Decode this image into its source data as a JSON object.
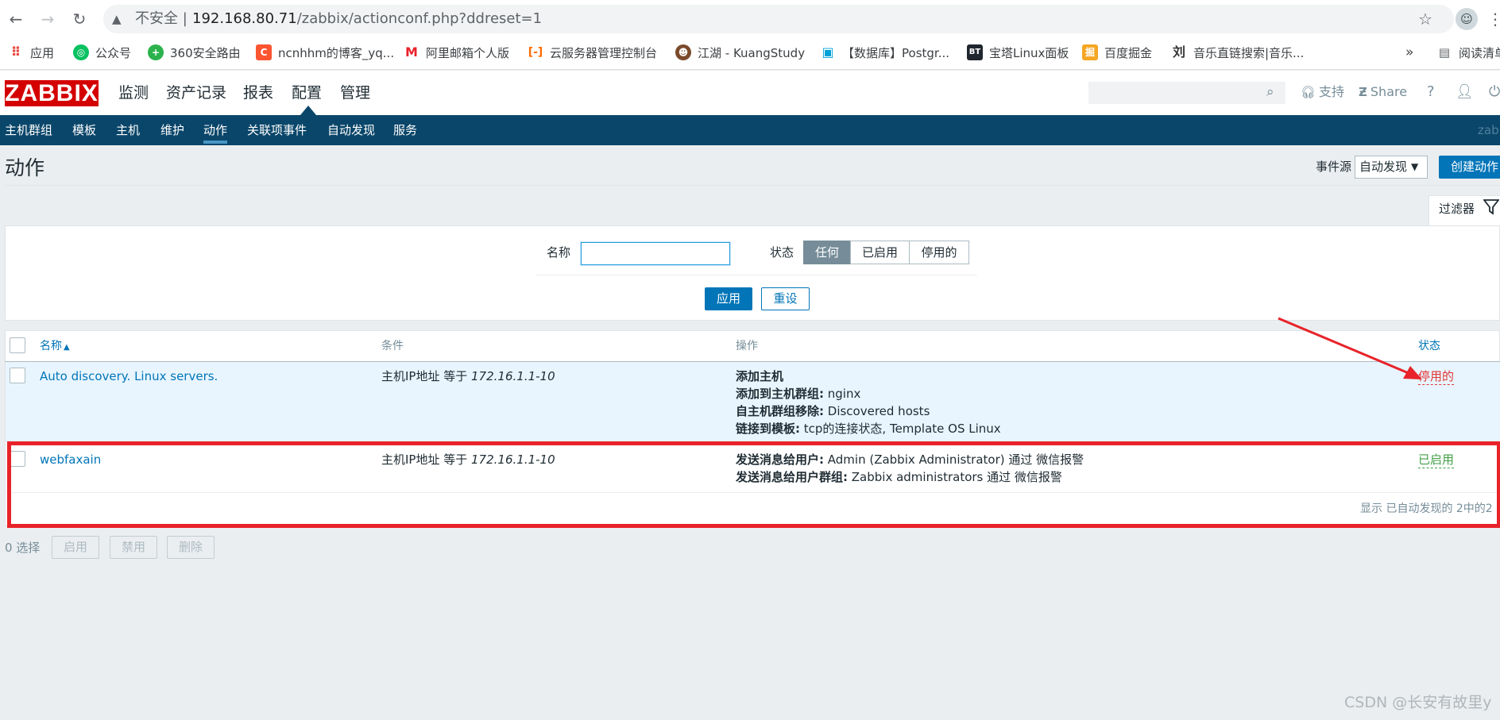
{
  "browser": {
    "insecure_label": "不安全",
    "url_host": "192.168.80.71",
    "url_path": "/zabbix/actionconf.php?ddreset=1",
    "bookmarks": [
      {
        "label": "应用",
        "icon": "apps-grid-icon",
        "color": "#e8453c"
      },
      {
        "label": "公众号",
        "icon": "wechat-icon",
        "color": "#07c160"
      },
      {
        "label": "360安全路由",
        "icon": "360-icon",
        "color": "#2bb24c"
      },
      {
        "label": "ncnhhm的博客_yq...",
        "icon": "csdn-c-icon",
        "color": "#fc5531"
      },
      {
        "label": "阿里邮箱个人版",
        "icon": "alimail-icon",
        "color": "#e8232a"
      },
      {
        "label": "云服务器管理控制台",
        "icon": "aliyun-icon",
        "color": "#ff6a00"
      },
      {
        "label": "江湖 - KuangStudy",
        "icon": "kuangstudy-icon",
        "color": "#7a4a2a"
      },
      {
        "label": "【数据库】Postgr...",
        "icon": "bilibili-icon",
        "color": "#00a1d6"
      },
      {
        "label": "宝塔Linux面板",
        "icon": "bt-icon",
        "color": "#20262e"
      },
      {
        "label": "百度掘金",
        "icon": "juejin-icon",
        "color": "#f5a623"
      },
      {
        "label": "音乐直链搜索|音乐...",
        "icon": "music-icon",
        "color": "#333333"
      }
    ],
    "more_bookmarks": "»",
    "reading_list": "阅读清单"
  },
  "header": {
    "logo": "ZABBIX",
    "menu": [
      "监测",
      "资产记录",
      "报表",
      "配置",
      "管理"
    ],
    "support": "支持",
    "share": "Share",
    "help": "?"
  },
  "subnav": {
    "items": [
      "主机群组",
      "模板",
      "主机",
      "维护",
      "动作",
      "关联项事件",
      "自动发现",
      "服务"
    ],
    "user": "zabb"
  },
  "page": {
    "title": "动作",
    "event_source_label": "事件源",
    "event_source_value": "自动发现",
    "create_button": "创建动作"
  },
  "filter": {
    "tab_label": "过滤器",
    "name_label": "名称",
    "name_value": "",
    "status_label": "状态",
    "status_options": [
      "任何",
      "已启用",
      "停用的"
    ],
    "apply": "应用",
    "reset": "重设"
  },
  "table": {
    "columns": {
      "name": "名称",
      "sort_indicator": "▲",
      "conditions": "条件",
      "operations": "操作",
      "status": "状态"
    },
    "rows": [
      {
        "name": "Auto discovery. Linux servers.",
        "condition_prefix": "主机IP地址 等于 ",
        "condition_value": "172.16.1.1-10",
        "operations": [
          {
            "label": "添加主机",
            "value": ""
          },
          {
            "label": "添加到主机群组:",
            "value": " nginx"
          },
          {
            "label": "自主机群组移除:",
            "value": " Discovered hosts"
          },
          {
            "label": "链接到模板:",
            "value": " tcp的连接状态, Template OS Linux"
          }
        ],
        "status": "停用的",
        "status_color": "#e33734"
      },
      {
        "name": "webfaxain",
        "condition_prefix": "主机IP地址 等于 ",
        "condition_value": "172.16.1.1-10",
        "operations": [
          {
            "label": "发送消息给用户:",
            "value": " Admin (Zabbix Administrator) 通过 微信报警"
          },
          {
            "label": "发送消息给用户群组:",
            "value": " Zabbix administrators 通过 微信报警"
          }
        ],
        "status": "已启用",
        "status_color": "#429e47"
      }
    ],
    "summary": "显示 已自动发现的 2中的2"
  },
  "bulk": {
    "selected": "0 选择",
    "enable": "启用",
    "disable": "禁用",
    "delete": "删除"
  },
  "watermark": "CSDN @长安有故里y",
  "colors": {
    "brand_red": "#d40000",
    "subnav_blue": "#0a466a",
    "primary": "#0275b8",
    "annotation_red": "#e8232a"
  }
}
